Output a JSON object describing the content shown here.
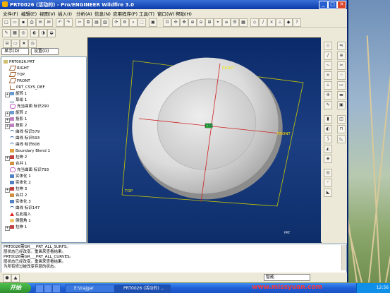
{
  "window": {
    "title": "PRT0026 (活动的) - Pro/ENGINEER Wildfire 3.0",
    "min_label": "_",
    "max_label": "□",
    "close_label": "✕"
  },
  "menubar": {
    "items": [
      "文件(F)",
      "编辑(E)",
      "视图(V)",
      "插入(I)",
      "分析(A)",
      "信息(N)",
      "应用程序(P)",
      "工具(T)",
      "窗口(W)",
      "帮助(H)"
    ]
  },
  "panel": {
    "show_label": "显示(D)",
    "settings_label": "设置(G)"
  },
  "tree": {
    "items": [
      {
        "label": "PRT0026.PRT",
        "icon": "part-icon"
      },
      {
        "label": "RIGHT",
        "icon": "datum-plane-icon"
      },
      {
        "label": "TOP",
        "icon": "datum-plane-icon"
      },
      {
        "label": "FRONT",
        "icon": "datum-plane-icon"
      },
      {
        "label": "PRT_CSYS_DEF",
        "icon": "csys-icon"
      },
      {
        "label": "旋转 1",
        "icon": "revolve-icon",
        "expand": true
      },
      {
        "label": "草绘 1",
        "icon": "sketch-icon"
      },
      {
        "label": "充当曲面 标识290",
        "icon": "surface-icon"
      },
      {
        "label": "旋转 2",
        "icon": "revolve-icon",
        "expand": true
      },
      {
        "label": "投影 1",
        "icon": "project-icon",
        "expand": true
      },
      {
        "label": "投影 2",
        "icon": "project-icon",
        "expand": true
      },
      {
        "label": "曲线 标识579",
        "icon": "curve-icon"
      },
      {
        "label": "曲线 标识593",
        "icon": "curve-icon"
      },
      {
        "label": "曲线 标识608",
        "icon": "curve-icon"
      },
      {
        "label": "Boundary Blend 1",
        "icon": "blend-icon"
      },
      {
        "label": "拉伸 2",
        "icon": "extrude-icon",
        "expand": true
      },
      {
        "label": "合并 1",
        "icon": "merge-icon"
      },
      {
        "label": "充当曲面 标识793",
        "icon": "surface-icon"
      },
      {
        "label": "实体化 1",
        "icon": "solidify-icon"
      },
      {
        "label": "实体化 2",
        "icon": "solidify-icon"
      },
      {
        "label": "拉伸 3",
        "icon": "extrude-icon",
        "expand": true
      },
      {
        "label": "合并 2",
        "icon": "merge-icon"
      },
      {
        "label": "实体化 3",
        "icon": "solidify-icon"
      },
      {
        "label": "曲线 标识147",
        "icon": "curve-icon"
      },
      {
        "label": "在此插入",
        "icon": "insert-here-icon"
      },
      {
        "label": "倒圆角 1",
        "icon": "round-icon"
      },
      {
        "label": "拉伸 1",
        "icon": "extrude-icon",
        "expand": true
      }
    ]
  },
  "graphics": {
    "plane_labels": {
      "right": "RIGHT",
      "front": "FRONT",
      "top": "TOP"
    },
    "csys_label": "CSO",
    "corner_label": "PRT"
  },
  "messages": [
    "PRT0026需GR___PRT_ALL_SURFS。",
    "层状态已经改变。重画来查看结果。",
    "PRT0026需GR___PRT_ALL_CURVES。",
    "层状态已经改变。重画来查看结果。",
    "为所有修过被改变存层的状态。"
  ],
  "status": {
    "filter_value": "智能"
  },
  "taskbar": {
    "start_label": "开始",
    "tasks": [
      "E:\\trajgar",
      "PRT0026 (活动的) ..."
    ],
    "clock": "12:56"
  },
  "watermark": "www.missyuan.com",
  "colors": {
    "titlebar": "#0a3aa8",
    "graphics_bg": "#1c3f82",
    "datum_plane": "#c8c800",
    "axis_red": "#d02020"
  }
}
